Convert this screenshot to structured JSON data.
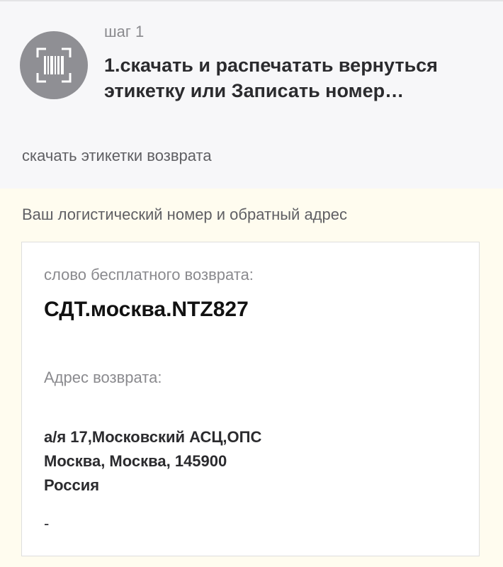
{
  "step": {
    "label": "шаг 1",
    "title": "1.скачать и распечатать вернуться этикетку или Записать номер…",
    "icon": "barcode-scan-icon",
    "icon_bg": "#8f8f94"
  },
  "download_link": "скачать этикетки возврата",
  "section": {
    "label": "Ваш логистический номер и обратный адрес"
  },
  "info": {
    "code_label": "слово бесплатного возврата:",
    "code_value": "СДТ.москва.NTZ827",
    "address_label": "Адрес возврата:",
    "address_lines": [
      "а/я 17,Московский АСЦ,ОПС",
      "Москва, Москва, 145900",
      "Россия"
    ],
    "extra": "-"
  },
  "colors": {
    "page_bg": "#fffcef",
    "card_bg": "#f7f7f9",
    "box_bg": "#ffffff"
  }
}
